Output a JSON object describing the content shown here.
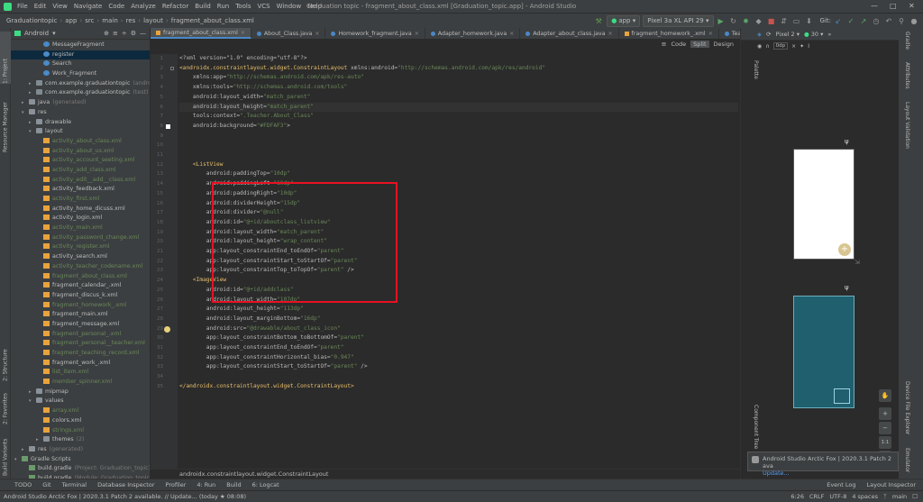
{
  "menu": [
    "File",
    "Edit",
    "View",
    "Navigate",
    "Code",
    "Analyze",
    "Refactor",
    "Build",
    "Run",
    "Tools",
    "VCS",
    "Window",
    "Help"
  ],
  "window_title": "Graduation topic - fragment_about_class.xml [Graduation_topic.app] - Android Studio",
  "breadcrumbs": [
    "Graduationtopic",
    "app",
    "src",
    "main",
    "res",
    "layout",
    "fragment_about_class.xml"
  ],
  "toolbar": {
    "run_config": "app",
    "device": "Pixel 3a XL API 29",
    "git_label": "Git:"
  },
  "left_strip": [
    "1: Project",
    "Resource Manager",
    "2: Structure",
    "2: Favorites",
    "Build Variants"
  ],
  "project": {
    "view_label": "Android",
    "tree": [
      {
        "label": "MessageFragment",
        "depth": 4,
        "icon": "java",
        "style": "normal"
      },
      {
        "label": "register",
        "depth": 4,
        "icon": "java",
        "style": "sel"
      },
      {
        "label": "Search",
        "depth": 4,
        "icon": "java",
        "style": "normal"
      },
      {
        "label": "Work_Fragment",
        "depth": 4,
        "icon": "java",
        "style": "normal"
      },
      {
        "label": "com.example.graduationtopic",
        "suffix": "(androidTest)",
        "depth": 3,
        "icon": "pkg",
        "arrow": ">",
        "style": "normal"
      },
      {
        "label": "com.example.graduationtopic",
        "suffix": "(test)",
        "depth": 3,
        "icon": "pkg",
        "arrow": ">",
        "style": "normal"
      },
      {
        "label": "java",
        "suffix": "(generated)",
        "depth": 2,
        "icon": "folder",
        "arrow": ">",
        "style": "normal"
      },
      {
        "label": "res",
        "depth": 2,
        "icon": "folder",
        "arrow": "v",
        "style": "normal"
      },
      {
        "label": "drawable",
        "depth": 3,
        "icon": "folder",
        "arrow": ">",
        "style": "normal"
      },
      {
        "label": "layout",
        "depth": 3,
        "icon": "folder",
        "arrow": "v",
        "style": "normal"
      },
      {
        "label": "activity_about_class.xml",
        "depth": 4,
        "icon": "xml",
        "style": "green"
      },
      {
        "label": "activity_about_us.xml",
        "depth": 4,
        "icon": "xml",
        "style": "green"
      },
      {
        "label": "activity_account_seeting.xml",
        "depth": 4,
        "icon": "xml",
        "style": "green"
      },
      {
        "label": "activity_add_class.xml",
        "depth": 4,
        "icon": "xml",
        "style": "green"
      },
      {
        "label": "activity_edit__add__class.xml",
        "depth": 4,
        "icon": "xml",
        "style": "green"
      },
      {
        "label": "activity_feedback.xml",
        "depth": 4,
        "icon": "xml",
        "style": "normal"
      },
      {
        "label": "activity_first.xml",
        "depth": 4,
        "icon": "xml",
        "style": "green"
      },
      {
        "label": "activity_home_dicuss.xml",
        "depth": 4,
        "icon": "xml",
        "style": "normal"
      },
      {
        "label": "activity_login.xml",
        "depth": 4,
        "icon": "xml",
        "style": "normal"
      },
      {
        "label": "activity_main.xml",
        "depth": 4,
        "icon": "xml",
        "style": "green"
      },
      {
        "label": "activity_password_change.xml",
        "depth": 4,
        "icon": "xml",
        "style": "green"
      },
      {
        "label": "activity_register.xml",
        "depth": 4,
        "icon": "xml",
        "style": "green"
      },
      {
        "label": "activity_search.xml",
        "depth": 4,
        "icon": "xml",
        "style": "normal"
      },
      {
        "label": "activity_teacher_codename.xml",
        "depth": 4,
        "icon": "xml",
        "style": "green"
      },
      {
        "label": "fragment_about_class.xml",
        "depth": 4,
        "icon": "xml",
        "style": "green"
      },
      {
        "label": "fragment_calendar_.xml",
        "depth": 4,
        "icon": "xml",
        "style": "normal"
      },
      {
        "label": "fragment_discus_k.xml",
        "depth": 4,
        "icon": "xml",
        "style": "normal"
      },
      {
        "label": "fragment_homework_.xml",
        "depth": 4,
        "icon": "xml",
        "style": "green"
      },
      {
        "label": "fragment_main.xml",
        "depth": 4,
        "icon": "xml",
        "style": "normal"
      },
      {
        "label": "fragment_message.xml",
        "depth": 4,
        "icon": "xml",
        "style": "normal"
      },
      {
        "label": "fragment_personal_.xml",
        "depth": 4,
        "icon": "xml",
        "style": "green"
      },
      {
        "label": "fragment_personal__teacher.xml",
        "depth": 4,
        "icon": "xml",
        "style": "green"
      },
      {
        "label": "fragment_teaching_record.xml",
        "depth": 4,
        "icon": "xml",
        "style": "green"
      },
      {
        "label": "fragment_work_.xml",
        "depth": 4,
        "icon": "xml",
        "style": "normal"
      },
      {
        "label": "list_item.xml",
        "depth": 4,
        "icon": "xml",
        "style": "green"
      },
      {
        "label": "member_spinner.xml",
        "depth": 4,
        "icon": "xml",
        "style": "green"
      },
      {
        "label": "mipmap",
        "depth": 3,
        "icon": "folder",
        "arrow": ">",
        "style": "normal"
      },
      {
        "label": "values",
        "depth": 3,
        "icon": "folder",
        "arrow": "v",
        "style": "normal"
      },
      {
        "label": "array.xml",
        "depth": 4,
        "icon": "xml",
        "style": "green"
      },
      {
        "label": "colors.xml",
        "depth": 4,
        "icon": "xml",
        "style": "normal"
      },
      {
        "label": "strings.xml",
        "depth": 4,
        "icon": "xml",
        "style": "green"
      },
      {
        "label": "themes",
        "suffix": "(2)",
        "depth": 4,
        "icon": "folder",
        "arrow": ">",
        "style": "normal"
      },
      {
        "label": "res",
        "suffix": "(generated)",
        "depth": 2,
        "icon": "folder",
        "arrow": ">",
        "style": "normal"
      },
      {
        "label": "Gradle Scripts",
        "depth": 1,
        "icon": "gradle",
        "arrow": "v",
        "style": "normal"
      },
      {
        "label": "build.gradle",
        "suffix": "(Project: Graduation_topic)",
        "depth": 2,
        "icon": "gradle",
        "style": "normal"
      },
      {
        "label": "build.gradle",
        "suffix": "(Module: Graduation_topic.app)",
        "depth": 2,
        "icon": "gradle",
        "style": "normal"
      }
    ]
  },
  "tabs": [
    {
      "label": "fragment_about_class.xml",
      "icon": "xml",
      "active": true
    },
    {
      "label": "About_Class.java",
      "icon": "java",
      "active": false
    },
    {
      "label": "Homework_fragment.java",
      "icon": "java",
      "active": false
    },
    {
      "label": "Adapter_homework.java",
      "icon": "java",
      "active": false
    },
    {
      "label": "Adapter_about_class.java",
      "icon": "java",
      "active": false
    },
    {
      "label": "fragment_homework_.xml",
      "icon": "xml",
      "active": false
    },
    {
      "label": "Teacher_Codename.java",
      "icon": "java",
      "active": false
    },
    {
      "label": "Account_seeting.java",
      "icon": "java",
      "active": false
    },
    {
      "label": "register.java",
      "icon": "java",
      "active": false
    }
  ],
  "view_modes": [
    "Code",
    "Split",
    "Design"
  ],
  "code": [
    {
      "n": "1",
      "parts": [
        [
          "d",
          "<?xml version=\"1.0\" encoding=\"utf-8\"?>"
        ]
      ]
    },
    {
      "n": "2",
      "parts": [
        [
          "t",
          "<androidx.constraintlayout.widget.ConstraintLayout "
        ],
        [
          "a",
          "xmlns:android="
        ],
        [
          "s",
          "\"http://schemas.android.com/apk/res/android\""
        ]
      ]
    },
    {
      "n": "3",
      "parts": [
        [
          "a",
          "    xmlns:app="
        ],
        [
          "s",
          "\"http://schemas.android.com/apk/res-auto\""
        ]
      ]
    },
    {
      "n": "4",
      "parts": [
        [
          "a",
          "    xmlns:tools="
        ],
        [
          "s",
          "\"http://schemas.android.com/tools\""
        ]
      ]
    },
    {
      "n": "5",
      "parts": [
        [
          "a",
          "    android:layout_width="
        ],
        [
          "s",
          "\"match_parent\""
        ]
      ]
    },
    {
      "n": "6",
      "cur": true,
      "parts": [
        [
          "a",
          "    android:layout_height="
        ],
        [
          "s",
          "\"match_parent\""
        ]
      ]
    },
    {
      "n": "7",
      "parts": [
        [
          "a",
          "    tools:context="
        ],
        [
          "s",
          "\".Teacher.About_Class\""
        ]
      ]
    },
    {
      "n": "8",
      "parts": [
        [
          "a",
          "    android:background="
        ],
        [
          "s",
          "\"#FDFAF3\""
        ],
        [
          "d",
          ">"
        ]
      ]
    },
    {
      "n": "9",
      "parts": []
    },
    {
      "n": "10",
      "parts": []
    },
    {
      "n": "11",
      "parts": []
    },
    {
      "n": "12",
      "parts": [
        [
          "t",
          "    <ListView"
        ]
      ]
    },
    {
      "n": "13",
      "parts": [
        [
          "a",
          "        android:paddingTop="
        ],
        [
          "s",
          "\"10dp\""
        ]
      ]
    },
    {
      "n": "14",
      "parts": [
        [
          "a",
          "        android:paddingLeft="
        ],
        [
          "s",
          "\"10dp\""
        ]
      ]
    },
    {
      "n": "15",
      "parts": [
        [
          "a",
          "        android:paddingRight="
        ],
        [
          "s",
          "\"10dp\""
        ]
      ]
    },
    {
      "n": "16",
      "parts": [
        [
          "a",
          "        android:dividerHeight="
        ],
        [
          "s",
          "\"15dp\""
        ]
      ]
    },
    {
      "n": "17",
      "parts": [
        [
          "a",
          "        android:divider="
        ],
        [
          "s",
          "\"@null\""
        ]
      ]
    },
    {
      "n": "18",
      "parts": [
        [
          "a",
          "        android:id="
        ],
        [
          "s",
          "\"@+id/aboutclass_listview\""
        ]
      ]
    },
    {
      "n": "19",
      "parts": [
        [
          "a",
          "        android:layout_width="
        ],
        [
          "s",
          "\"match_parent\""
        ]
      ]
    },
    {
      "n": "20",
      "parts": [
        [
          "a",
          "        android:layout_height="
        ],
        [
          "s",
          "\"wrap_content\""
        ]
      ]
    },
    {
      "n": "21",
      "parts": [
        [
          "a",
          "        app:layout_constraintEnd_toEndOf="
        ],
        [
          "s",
          "\"parent\""
        ]
      ]
    },
    {
      "n": "22",
      "parts": [
        [
          "a",
          "        app:layout_constraintStart_toStartOf="
        ],
        [
          "s",
          "\"parent\""
        ]
      ]
    },
    {
      "n": "23",
      "parts": [
        [
          "a",
          "        app:layout_constraintTop_toTopOf="
        ],
        [
          "s",
          "\"parent\""
        ],
        [
          "d",
          " />"
        ]
      ]
    },
    {
      "n": "24",
      "parts": [
        [
          "t",
          "    <ImageView"
        ]
      ]
    },
    {
      "n": "25",
      "parts": [
        [
          "a",
          "        android:id="
        ],
        [
          "s",
          "\"@+id/addclass\""
        ]
      ]
    },
    {
      "n": "26",
      "parts": [
        [
          "a",
          "        android:layout_width="
        ],
        [
          "s",
          "\"107dp\""
        ]
      ]
    },
    {
      "n": "27",
      "parts": [
        [
          "a",
          "        android:layout_height="
        ],
        [
          "s",
          "\"113dp\""
        ]
      ]
    },
    {
      "n": "28",
      "parts": [
        [
          "a",
          "        android:layout_marginBottom="
        ],
        [
          "s",
          "\"16dp\""
        ]
      ]
    },
    {
      "n": "29",
      "parts": [
        [
          "a",
          "        android:src="
        ],
        [
          "s",
          "\"@drawable/about_class_icon\""
        ]
      ]
    },
    {
      "n": "30",
      "parts": [
        [
          "a",
          "        app:layout_constraintBottom_toBottomOf="
        ],
        [
          "s",
          "\"parent\""
        ]
      ]
    },
    {
      "n": "31",
      "parts": [
        [
          "a",
          "        app:layout_constraintEnd_toEndOf="
        ],
        [
          "s",
          "\"parent\""
        ]
      ]
    },
    {
      "n": "32",
      "parts": [
        [
          "a",
          "        app:layout_constraintHorizontal_bias="
        ],
        [
          "s",
          "\"0.947\""
        ]
      ]
    },
    {
      "n": "33",
      "parts": [
        [
          "a",
          "        app:layout_constraintStart_toStartOf="
        ],
        [
          "s",
          "\"parent\""
        ],
        [
          "d",
          " />"
        ]
      ]
    },
    {
      "n": "34",
      "parts": []
    },
    {
      "n": "35",
      "parts": [
        [
          "t",
          "</androidx.constraintlayout.widget.ConstraintLayout>"
        ]
      ]
    }
  ],
  "editor_breadcrumb": "androidx.constraintlayout.widget.ConstraintLayout",
  "design": {
    "device": "Pixel 2",
    "api": "30",
    "margin": "0dp",
    "palette": "Palette",
    "component_tree": "Component Tree",
    "zoom_ratio": "1:1"
  },
  "right_strip": [
    "Gradle",
    "Attributes",
    "Layout Validation",
    "Device File Explorer",
    "Emulator"
  ],
  "notice": {
    "text": "Android Studio Arctic Fox | 2020.3.1 Patch 2 ava",
    "link": "Update..."
  },
  "toolwindows": [
    "TODO",
    "Git",
    "Terminal",
    "Database Inspector",
    "Profiler",
    "4: Run",
    "Build",
    "6: Logcat"
  ],
  "toolwindows_right": [
    "Event Log",
    "Layout Inspector"
  ],
  "status": {
    "message": "Android Studio Arctic Fox | 2020.3.1 Patch 2 available. // Update... (today ★ 08:08)",
    "position": "6:26",
    "line_sep": "CRLF",
    "encoding": "UTF-8",
    "indent": "4 spaces",
    "branch": "main"
  },
  "colors": {
    "highlight_box": "#e81123",
    "accent": "#4a88c7",
    "tag": "#e8bf6a",
    "string": "#6a8759"
  }
}
